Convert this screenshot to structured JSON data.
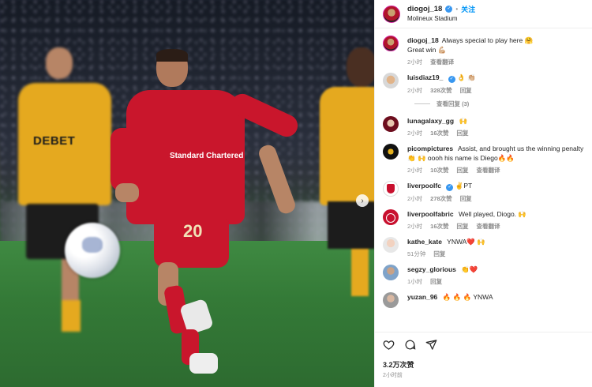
{
  "post": {
    "author": "diogoj_18",
    "follow_label": "关注",
    "location": "Molineux Stadium",
    "caption_text": "Always special to play here 🤗",
    "caption_line2": "Great win 💪🏼",
    "caption_time": "2小时",
    "caption_translate": "查看翻译",
    "likes": "3.2万次赞",
    "time_ago": "2小时前"
  },
  "photo": {
    "sponsor_left": "DEBET",
    "sponsor_main": "Standard Chartered",
    "shirt_number": "20"
  },
  "comments": [
    {
      "user": "luisdiaz19_",
      "text": "👌 👏🏼",
      "time": "2小时",
      "likes": "328次赞",
      "reply": "回复",
      "verified": true
    },
    {
      "user": "lunagalaxy_gg",
      "text": "🙌",
      "time": "2小时",
      "likes": "16次赞",
      "reply": "回复"
    },
    {
      "user": "picompictures",
      "text": "Assist, and brought us the winning penalty 👏 🙌 oooh his name is Diego🔥🔥",
      "time": "2小时",
      "likes": "10次赞",
      "reply": "回复",
      "translate": "查看翻译"
    },
    {
      "user": "liverpoolfc",
      "text": "✌️PT",
      "time": "2小时",
      "likes": "278次赞",
      "reply": "回复",
      "verified": true
    },
    {
      "user": "liverpoolfabric",
      "text": "Well played, Diogo. 🙌",
      "time": "2小时",
      "likes": "16次赞",
      "reply": "回复",
      "translate": "查看翻译"
    },
    {
      "user": "kathe_kate",
      "text": "YNWA❤️ 🙌",
      "time": "51分钟",
      "reply": "回复"
    },
    {
      "user": "segzy_glorious",
      "text": "👏❤️",
      "time": "1小时",
      "reply": "回复"
    },
    {
      "user": "yuzan_96",
      "text": "🔥 🔥 🔥 YNWA"
    }
  ],
  "view_replies": "查看回复 (3)"
}
